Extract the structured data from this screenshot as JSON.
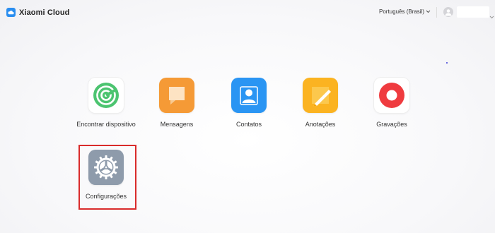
{
  "header": {
    "brand": "Xiaomi Cloud",
    "language": "Português (Brasil)"
  },
  "apps": [
    {
      "label": "Encontrar dispositivo",
      "icon": "find-device-icon",
      "color": "#4cc470"
    },
    {
      "label": "Mensagens",
      "icon": "messages-icon",
      "color": "#f59a36"
    },
    {
      "label": "Contatos",
      "icon": "contacts-icon",
      "color": "#2a95f3"
    },
    {
      "label": "Anotações",
      "icon": "notes-icon",
      "color": "#fbb321"
    },
    {
      "label": "Gravações",
      "icon": "recordings-icon",
      "color": "#ef3b3f"
    },
    {
      "label": "Configurações",
      "icon": "settings-gear-icon",
      "color": "#8e9bab",
      "highlighted": true
    }
  ],
  "colors": {
    "brand": "#2a8ef0",
    "highlight_border": "#d92b2b"
  }
}
